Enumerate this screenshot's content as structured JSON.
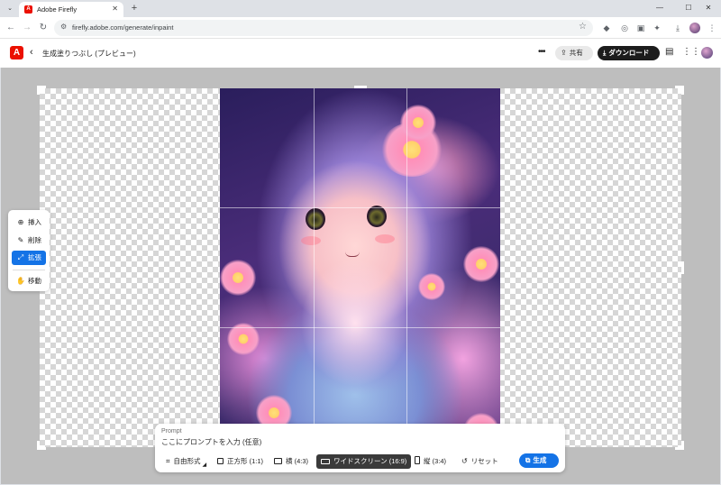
{
  "browser": {
    "tab_title": "Adobe Firefly",
    "url": "firefly.adobe.com/generate/inpaint",
    "tab_close": "✕",
    "new_tab": "+",
    "minimize": "—",
    "maximize": "☐",
    "close": "✕"
  },
  "app": {
    "title": "生成塗りつぶし (プレビュー)",
    "share_label": "共有",
    "download_label": "ダウンロード"
  },
  "tools": [
    {
      "label": "挿入",
      "icon": "insert-icon",
      "active": false
    },
    {
      "label": "削除",
      "icon": "eraser-icon",
      "active": false
    },
    {
      "label": "拡張",
      "icon": "expand-icon",
      "active": true
    },
    {
      "label": "移動",
      "icon": "hand-icon",
      "active": false
    }
  ],
  "prompt": {
    "label": "Prompt",
    "placeholder": "ここにプロンプトを入力 (任意)"
  },
  "aspect_options": {
    "free": "自由形式",
    "square": "正方形 (1:1)",
    "landscape": "横 (4:3)",
    "widescreen": "ワイドスクリーン (16:9)",
    "portrait": "縦 (3:4)",
    "reset": "リセット",
    "selected": "widescreen"
  },
  "generate_label": "生成",
  "colors": {
    "accent": "#1473e6",
    "adobe_red": "#eb1000",
    "download_bg": "#1c1c1c"
  }
}
